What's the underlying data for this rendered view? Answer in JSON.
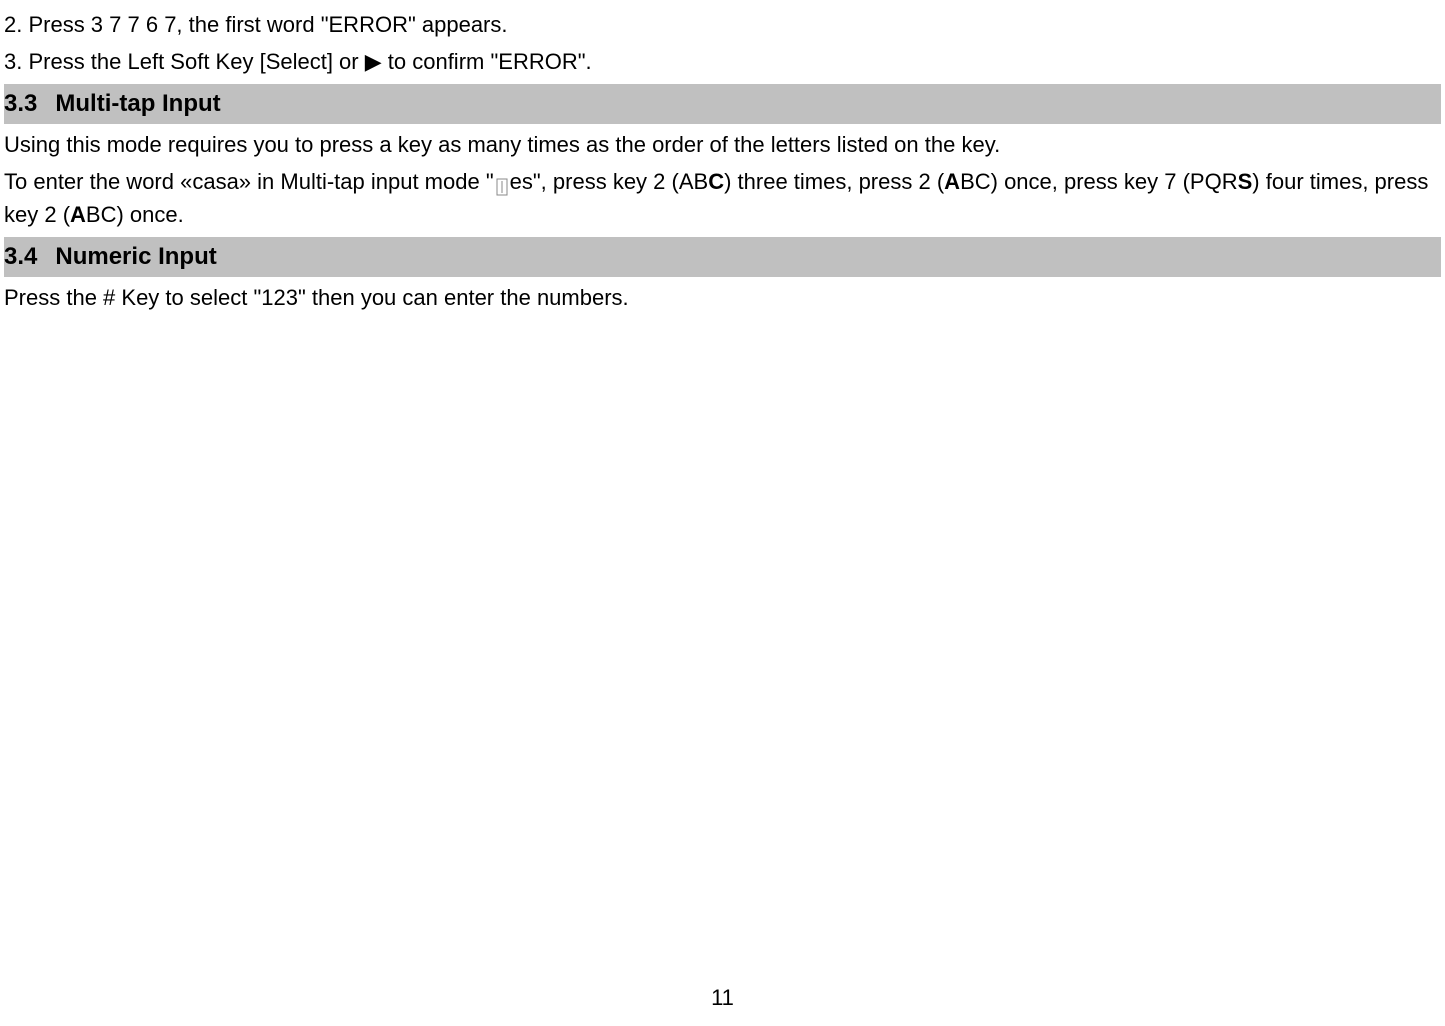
{
  "step2": "2. Press 3 7 7 6 7, the first word \"ERROR\" appears.",
  "step3": "3. Press the Left Soft Key [Select] or  ▶  to confirm \"ERROR\".",
  "section33": {
    "number": "3.3",
    "title": "Multi-tap Input",
    "para1": "Using this mode requires you to press a key as many times as the order of the letters listed on the key.",
    "para2_parts": {
      "p1": "To enter the word «casa» in Multi-tap input mode \"",
      "p2": "es\", press key 2 (AB",
      "b1": "C",
      "p3": ") three times, press 2 (",
      "b2": "A",
      "p4": "BC) once, press key 7 (PQR",
      "b3": "S",
      "p5": ") four times, press key 2 (",
      "b4": "A",
      "p6": "BC) once."
    }
  },
  "section34": {
    "number": "3.4",
    "title": "Numeric Input",
    "para1": "Press the # Key to select \"123\" then you can enter the numbers."
  },
  "page_number": "11"
}
